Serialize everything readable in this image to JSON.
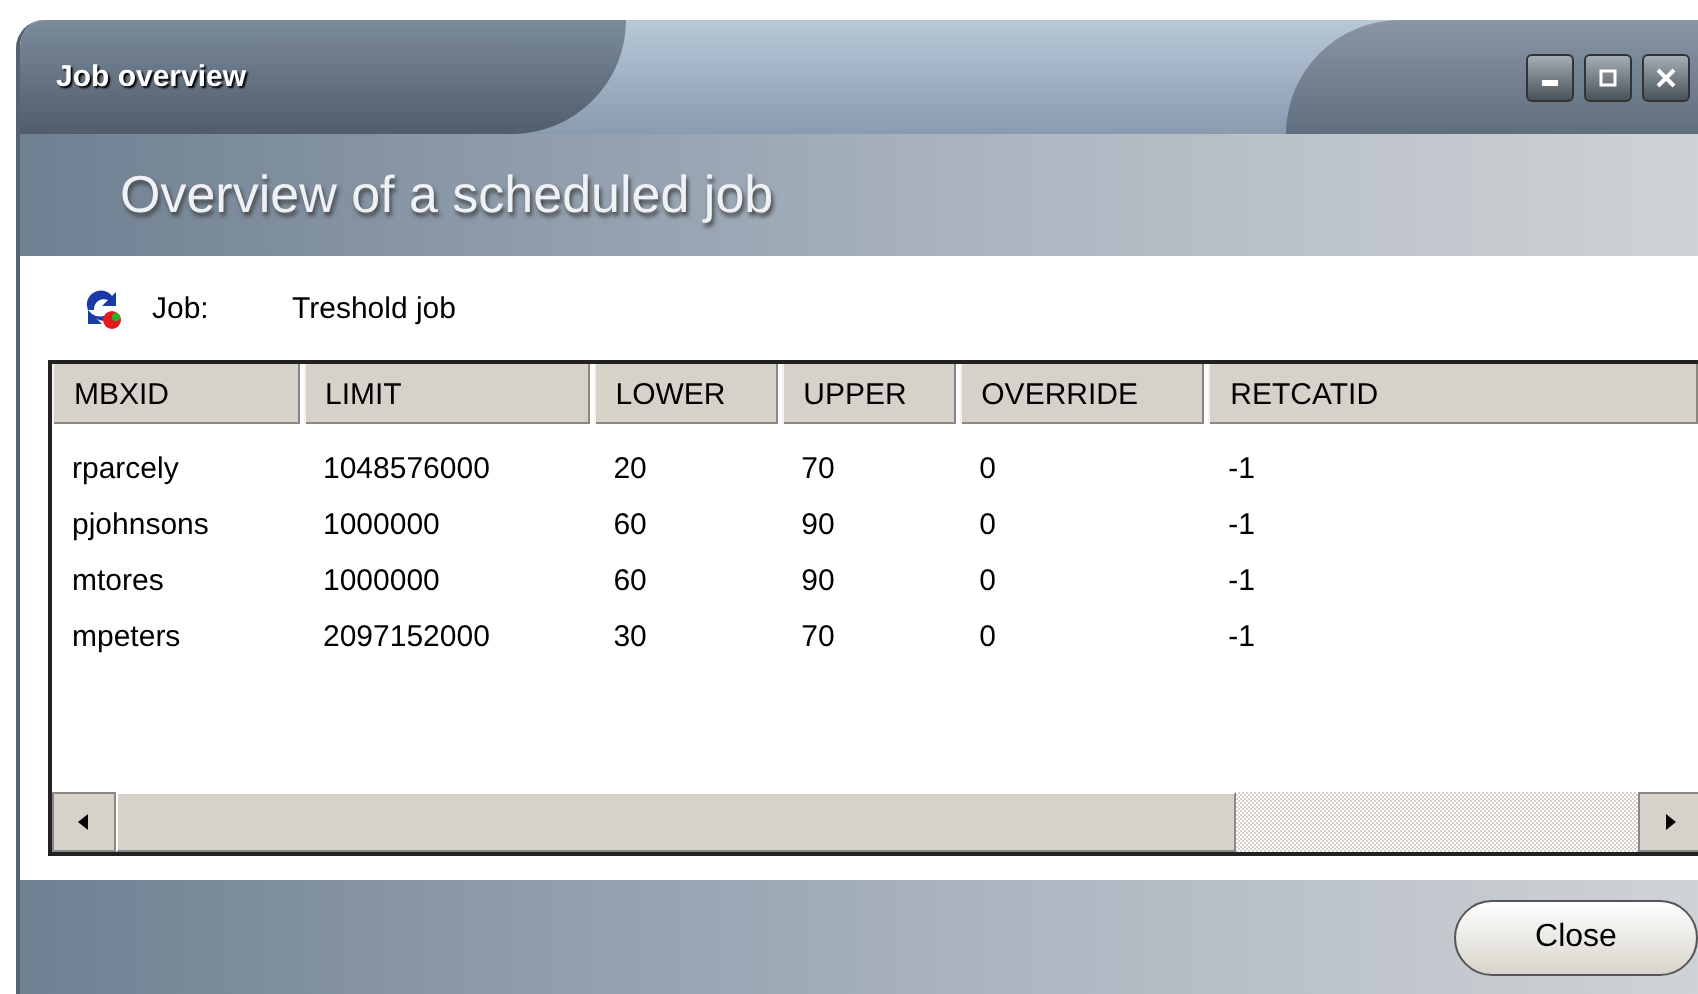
{
  "window": {
    "title": "Job overview"
  },
  "heading": "Overview of a scheduled job",
  "job": {
    "label": "Job:",
    "value": "Treshold job"
  },
  "table": {
    "columns": [
      "MBXID",
      "LIMIT",
      "LOWER",
      "UPPER",
      "OVERRIDE",
      "RETCATID"
    ],
    "rows": [
      [
        "rparcely",
        "1048576000",
        "20",
        "70",
        "0",
        "-1"
      ],
      [
        "pjohnsons",
        "1000000",
        "60",
        "90",
        "0",
        "-1"
      ],
      [
        "mtores",
        "1000000",
        "60",
        "90",
        "0",
        "-1"
      ],
      [
        "mpeters",
        "2097152000",
        "30",
        "70",
        "0",
        "-1"
      ]
    ]
  },
  "buttons": [
    "Close"
  ]
}
